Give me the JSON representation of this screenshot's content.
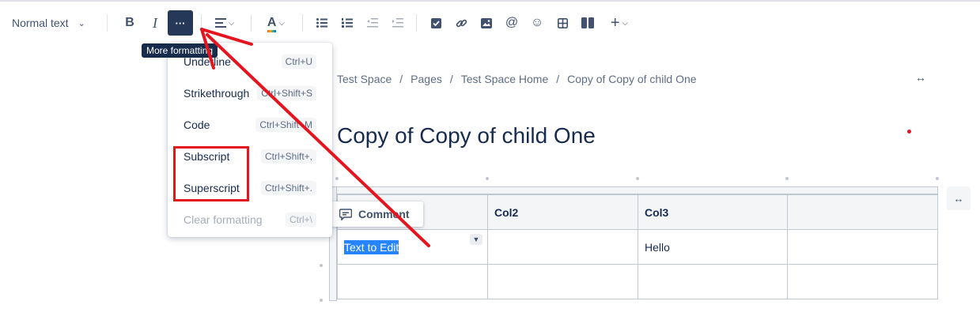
{
  "toolbar": {
    "text_style": "Normal text",
    "bold_glyph": "B",
    "italic_glyph": "I",
    "more_glyph": "···",
    "align_glyph": "≡",
    "text_color_glyph": "A",
    "chevron": "⌄",
    "plus_glyph": "+"
  },
  "tooltip": {
    "text": "More formatting"
  },
  "menu": {
    "items": [
      {
        "label": "Underline",
        "shortcut": "Ctrl+U"
      },
      {
        "label": "Strikethrough",
        "shortcut": "Ctrl+Shift+S"
      },
      {
        "label": "Code",
        "shortcut": "Ctrl+Shift+M"
      },
      {
        "label": "Subscript",
        "shortcut": "Ctrl+Shift+,"
      },
      {
        "label": "Superscript",
        "shortcut": "Ctrl+Shift+."
      },
      {
        "label": "Clear formatting",
        "shortcut": "Ctrl+\\"
      }
    ]
  },
  "breadcrumb": {
    "items": [
      "Test Space",
      "Pages",
      "Test Space Home",
      "Copy of Copy of child One"
    ],
    "separator": "/"
  },
  "page": {
    "title": "Copy of Copy of child One"
  },
  "table": {
    "header": [
      "",
      "Col2",
      "Col3",
      ""
    ],
    "rows": [
      [
        "Text to Edit",
        "",
        "Hello",
        ""
      ],
      [
        "",
        "",
        "",
        ""
      ]
    ]
  },
  "comment": {
    "label": "Comment"
  },
  "expand_glyph": "↔",
  "colors": {
    "annotation": "#e5151f",
    "selection": "#2684ff",
    "active_button": "#253858"
  }
}
